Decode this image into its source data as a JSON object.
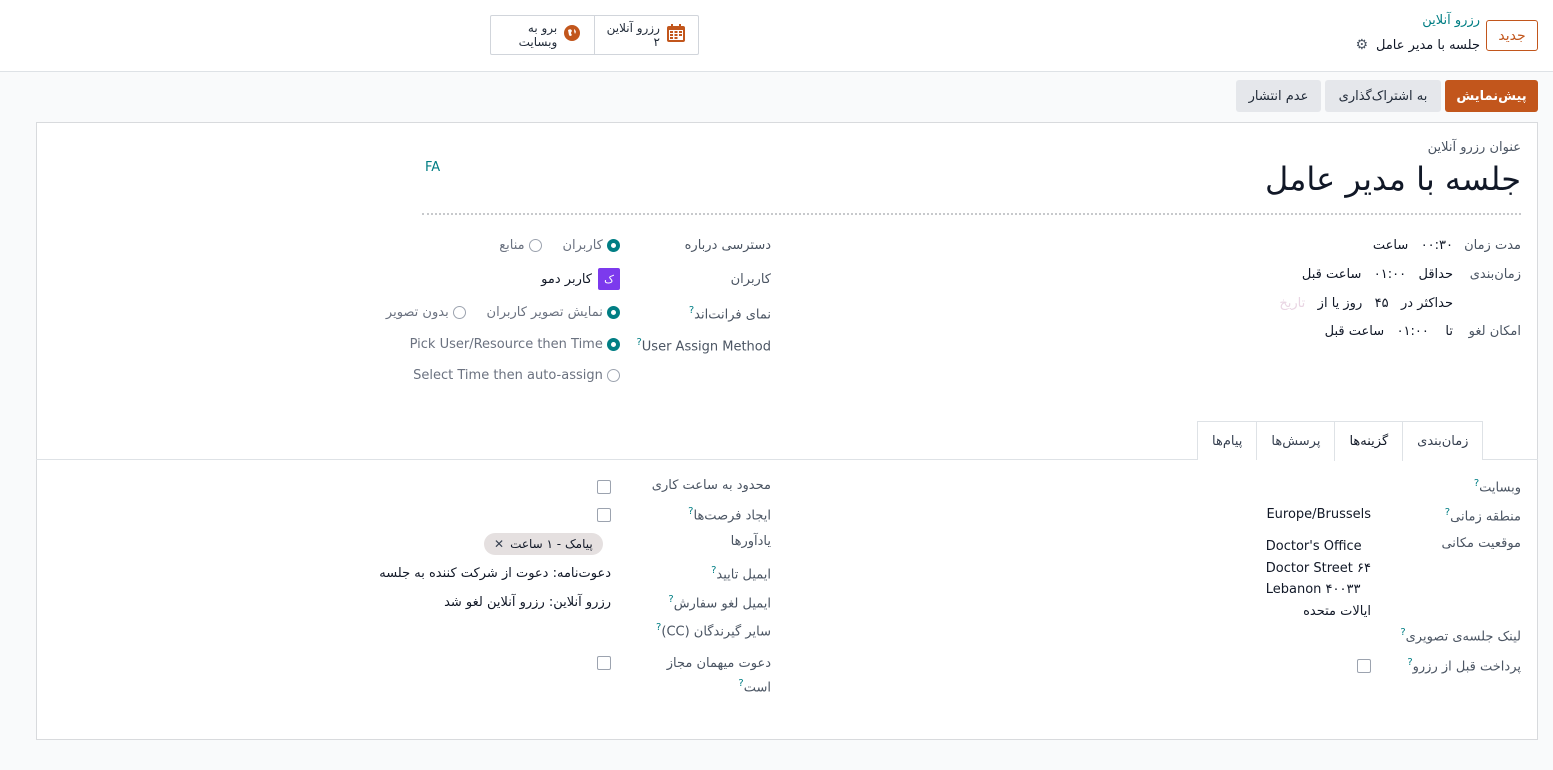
{
  "header": {
    "new_button": "جدید",
    "breadcrumb_parent": "رزرو آنلاین",
    "breadcrumb_current": "جلسه با مدیر عامل",
    "smart_buttons": {
      "website_label": "برو به وبسایت",
      "online_label": "رزرو آنلاین",
      "online_count": "۲"
    }
  },
  "actions": {
    "preview": "پیش‌نمایش",
    "share": "به اشتراک‌گذاری",
    "unpublish": "عدم انتشار"
  },
  "form": {
    "title_label": "عنوان رزرو آنلاین",
    "title": "جلسه با مدیر عامل",
    "lang": "FA",
    "duration_label": "مدت زمان",
    "duration_value": "۰۰:۳۰",
    "duration_unit": "ساعت",
    "scheduling_label": "زمان‌بندی",
    "min_label": "حداقل",
    "min_value": "۰۱:۰۰",
    "min_unit": "ساعت قبل",
    "max_label": "حداکثر در",
    "max_value": "۴۵",
    "max_unit": "روز یا از",
    "max_placeholder": "تاریخ",
    "cancel_label": "امکان لغو",
    "cancel_to": "تا",
    "cancel_value": "۰۱:۰۰",
    "cancel_unit": "ساعت قبل",
    "access_label": "دسترسی درباره",
    "access_users": "کاربران",
    "access_resources": "منابع",
    "users_label": "کاربران",
    "user_avatar": "ک",
    "user_name": "کاربر دمو",
    "frontend_label": "نمای فرانت‌اند",
    "frontend_show": "نمایش تصویر کاربران",
    "frontend_none": "بدون تصویر",
    "assign_label": "User Assign Method",
    "assign_opt1": "Pick User/Resource then Time",
    "assign_opt2": "Select Time then auto-assign"
  },
  "tabs": [
    "زمان‌بندی",
    "گزینه‌ها",
    "پرسش‌ها",
    "پیام‌ها"
  ],
  "options": {
    "website_label": "وبسایت",
    "timezone_label": "منطقه زمانی",
    "timezone_value": "Europe/Brussels",
    "location_label": "موقعیت مکانی",
    "location_lines": [
      "Doctor's Office",
      "Doctor Street ۶۴",
      "Lebanon ۴۰۰۳۳",
      "ایالات متحده"
    ],
    "video_label": "لینک جلسه‌ی تصویری",
    "prepay_label": "پرداخت قبل از رزرو",
    "limit_hours_label": "محدود به ساعت کاری",
    "create_slots_label": "ایجاد فرصت‌ها",
    "reminders_label": "یادآورها",
    "reminder_tag": "پیامک - ۱ ساعت",
    "confirm_email_label": "ایمیل تایید",
    "confirm_email_value": "دعوت‌نامه: دعوت از شرکت کننده به جلسه",
    "cancel_email_label": "ایمیل لغو سفارش",
    "cancel_email_value": "رزرو آنلاین: رزرو آنلاین لغو شد",
    "cc_label": "سایر گیرندگان (CC)",
    "guest_label_1": "دعوت میهمان مجاز",
    "guest_label_2": "است"
  },
  "colors": {
    "accent": "#017e84",
    "primary": "#c2561c"
  },
  "icons": {
    "website": "globe-icon",
    "calendar": "calendar-icon",
    "settings": "gear-icon"
  }
}
